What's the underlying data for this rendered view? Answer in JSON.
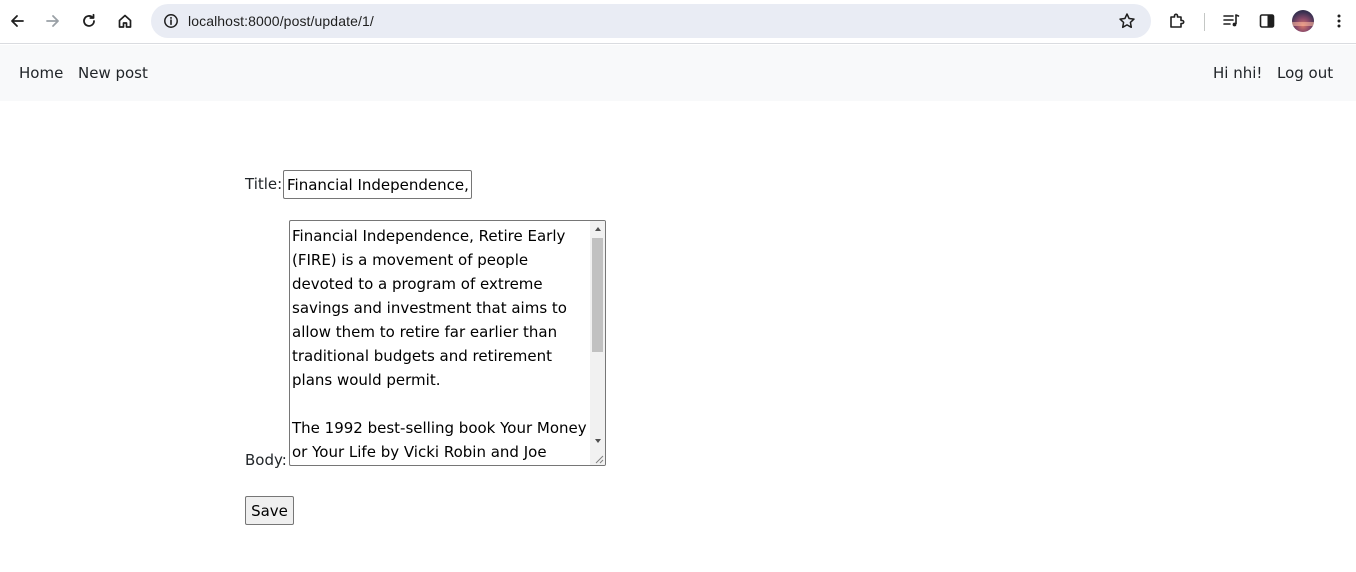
{
  "browser": {
    "url": "localhost:8000/post/update/1/",
    "icons": {
      "back": "arrow-left-icon",
      "forward": "arrow-right-icon",
      "reload": "reload-icon",
      "home": "home-icon",
      "site_info": "info-icon",
      "bookmark": "star-icon",
      "extensions": "puzzle-icon",
      "media": "media-queue-icon",
      "side_panel": "side-panel-icon",
      "menu": "kebab-menu-icon"
    }
  },
  "nav": {
    "left": [
      {
        "label": "Home"
      },
      {
        "label": "New post"
      }
    ],
    "greeting": "Hi nhi!",
    "logout": "Log out"
  },
  "form": {
    "title_label": "Title:",
    "title_value": "Financial Independence, Retire Early",
    "body_label": "Body:",
    "body_value": "Financial Independence, Retire Early (FIRE) is a movement of people devoted to a program of extreme savings and investment that aims to allow them to retire far earlier than traditional budgets and retirement plans would permit.\n\nThe 1992 best-selling book Your Money or Your Life by Vicki Robin and Joe Dominguez popularized many of the",
    "save_label": "Save"
  },
  "colors": {
    "nav_bg": "#f8f9fa",
    "omnibox_bg": "#e9ecf4",
    "button_bg": "#efefef",
    "scrollbar_thumb": "#c1c1c1"
  }
}
